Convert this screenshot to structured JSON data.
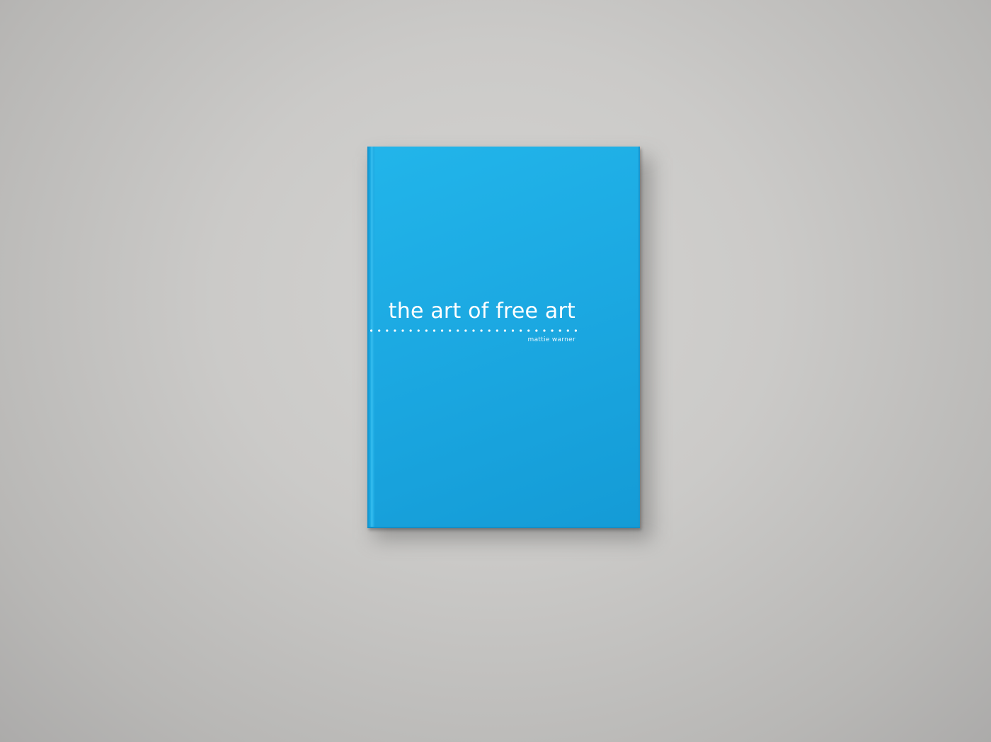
{
  "scene": {
    "background_color": "#cbcac8"
  },
  "book": {
    "cover_color": "#1ca9e2",
    "title": "the art of free art",
    "author": "mattie warner",
    "dotted_rule": {
      "dot_count": 27,
      "dot_color": "#ffffff"
    }
  }
}
